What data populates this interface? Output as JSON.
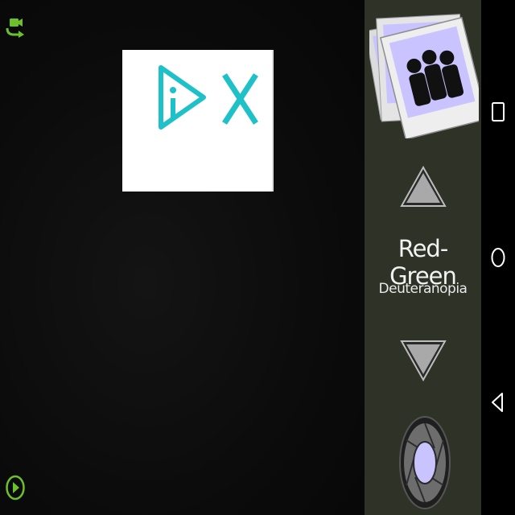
{
  "mode": {
    "title": "Red-Green",
    "subtitle": "Deuteranopia"
  },
  "icons": {
    "switch_camera": "switch-camera-icon",
    "ad_badge": "adchoices-icon",
    "ad_close": "close-icon",
    "play_small": "play-circle-icon",
    "gallery": "gallery-icon",
    "prev_mode": "triangle-up-icon",
    "next_mode": "triangle-down-icon",
    "shutter": "aperture-icon",
    "recents": "square-icon",
    "home": "circle-icon",
    "back": "triangle-left-icon"
  },
  "colors": {
    "panel": "#2f3327",
    "accent_green": "#6ec02a",
    "ad_teal": "#1fc1c9",
    "photo_lavender": "#c9c3ff",
    "nav_bar": "#000000"
  }
}
